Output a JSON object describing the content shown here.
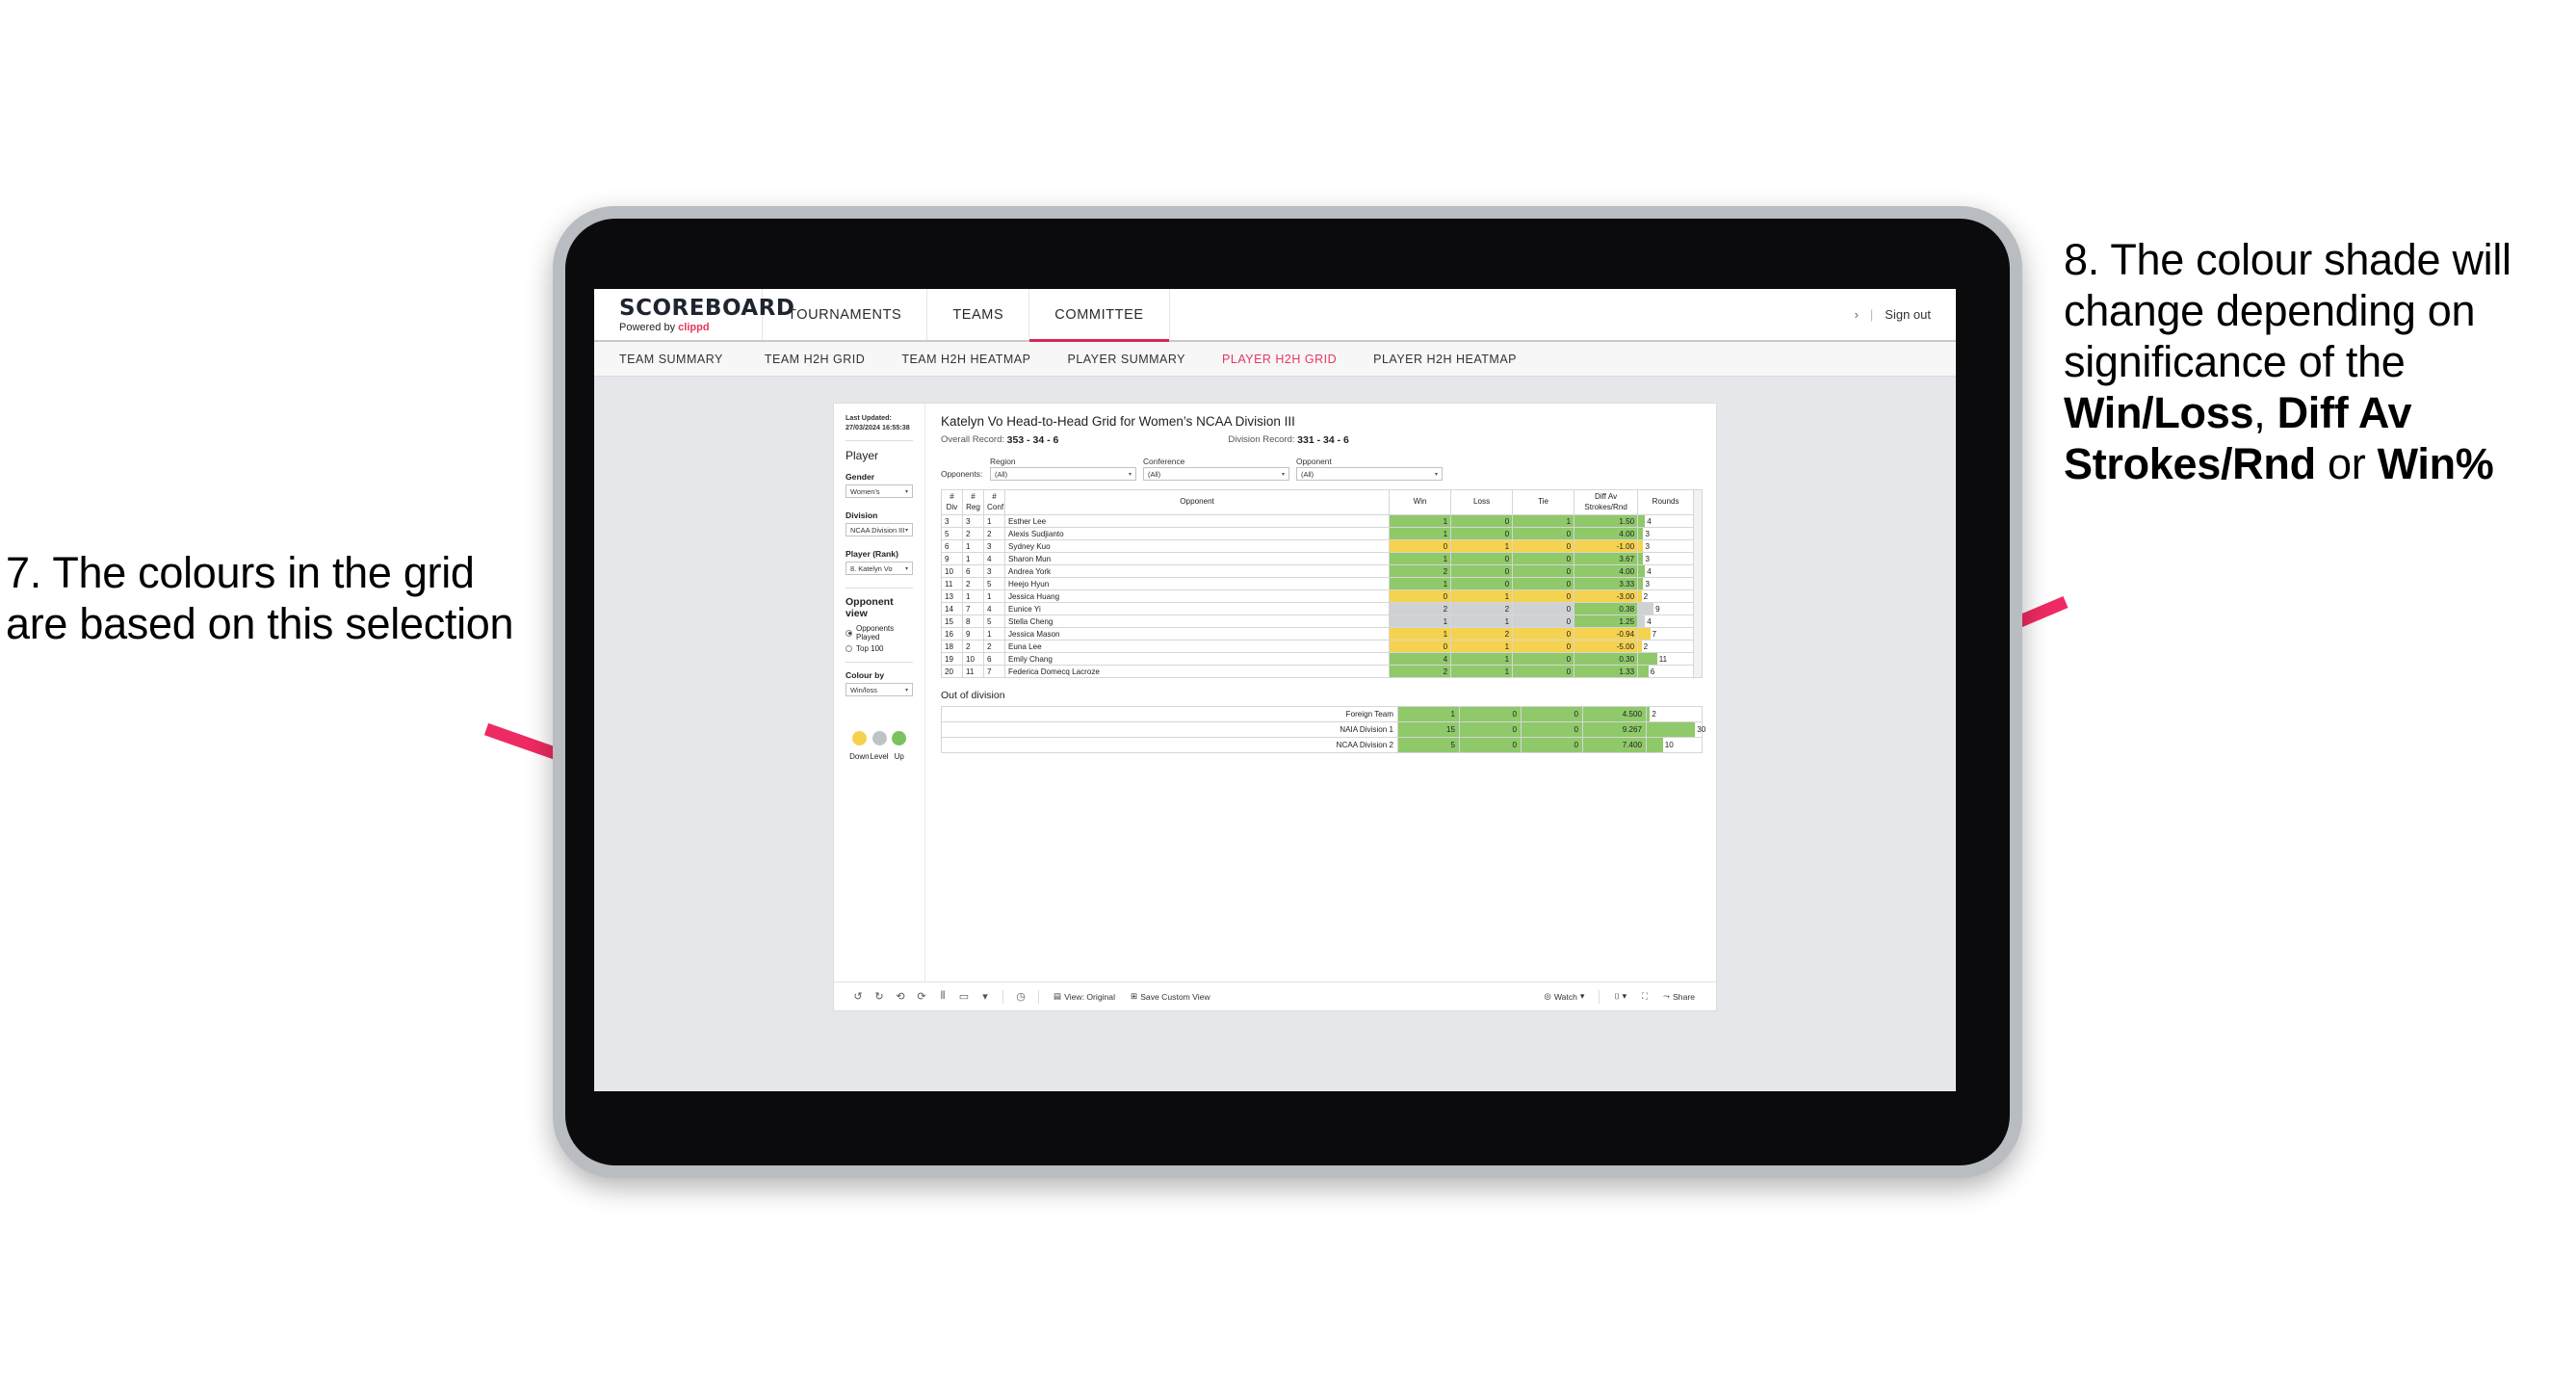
{
  "annotations": {
    "left": {
      "parts": [
        {
          "t": "7. The colours in the grid are based on this selection",
          "b": false
        }
      ]
    },
    "right": {
      "parts": [
        {
          "t": "8. The colour shade will change depending on significance of the ",
          "b": false
        },
        {
          "t": "Win/Loss",
          "b": true
        },
        {
          "t": ", ",
          "b": false
        },
        {
          "t": "Diff Av Strokes/Rnd",
          "b": true
        },
        {
          "t": " or ",
          "b": false
        },
        {
          "t": "Win%",
          "b": true
        }
      ]
    },
    "arrow_color": "#ee2a62"
  },
  "app": {
    "brand": {
      "title": "SCOREBOARD",
      "powered_prefix": "Powered by ",
      "powered_brand": "clippd"
    },
    "top_nav": [
      {
        "label": "TOURNAMENTS",
        "active": false
      },
      {
        "label": "TEAMS",
        "active": false
      },
      {
        "label": "COMMITTEE",
        "active": true
      }
    ],
    "top_right": {
      "chevron": "›",
      "separator": "|",
      "sign_out": "Sign out"
    },
    "sub_nav": [
      {
        "label": "TEAM SUMMARY",
        "active": false
      },
      {
        "label": "TEAM H2H GRID",
        "active": false
      },
      {
        "label": "TEAM H2H HEATMAP",
        "active": false
      },
      {
        "label": "PLAYER SUMMARY",
        "active": false
      },
      {
        "label": "PLAYER H2H GRID",
        "active": true
      },
      {
        "label": "PLAYER H2H HEATMAP",
        "active": false
      }
    ],
    "accent_color": "#e8365d"
  },
  "panel": {
    "last_updated": "Last Updated: 27/03/2024 16:55:38",
    "heading": "Player",
    "fields": [
      {
        "label": "Gender",
        "value": "Women’s"
      },
      {
        "label": "Division",
        "value": "NCAA Division III"
      },
      {
        "label": "Player (Rank)",
        "value": "8. Katelyn Vo"
      }
    ],
    "opponent_view": {
      "heading": "Opponent view",
      "options": [
        {
          "label": "Opponents Played",
          "selected": true
        },
        {
          "label": "Top 100",
          "selected": false
        }
      ]
    },
    "colour_by": {
      "label": "Colour by",
      "value": "Win/loss"
    },
    "legend": [
      {
        "label": "Down",
        "color": "#f4d14e"
      },
      {
        "label": "Level",
        "color": "#bfc3c7"
      },
      {
        "label": "Up",
        "color": "#7ac35c"
      }
    ]
  },
  "main": {
    "title": "Katelyn Vo Head-to-Head Grid for Women’s NCAA Division III",
    "overall_record_label": "Overall Record:",
    "overall_record_value": "353 -  34 - 6",
    "division_record_label": "Division Record:",
    "division_record_value": "331 -  34 - 6",
    "opponents_label": "Opponents:",
    "opponent_filters": [
      {
        "label": "Region",
        "value": "(All)"
      },
      {
        "label": "Conference",
        "value": "(All)"
      },
      {
        "label": "Opponent",
        "value": "(All)"
      }
    ],
    "out_of_division_heading": "Out of division"
  },
  "chart_data": {
    "type": "table",
    "title": "Katelyn Vo Head-to-Head Grid for Women’s NCAA Division III",
    "columns": [
      "# Div",
      "# Reg",
      "# Conf",
      "Opponent",
      "Win",
      "Loss",
      "Tie",
      "Diff Av Strokes/Rnd",
      "Rounds"
    ],
    "column_header_lines": [
      [
        "#",
        "Div"
      ],
      [
        "#",
        "Reg"
      ],
      [
        "#",
        "Conf"
      ],
      [
        "Opponent",
        ""
      ],
      [
        "Win",
        ""
      ],
      [
        "Loss",
        ""
      ],
      [
        "Tie",
        ""
      ],
      [
        "Diff Av",
        "Strokes/Rnd"
      ],
      [
        "Rounds",
        ""
      ]
    ],
    "colors": {
      "up": "#8fc96a",
      "down": "#f5d24f",
      "level": "#cfd2d4",
      "white": "#ffffff"
    },
    "rounds_max": 32,
    "rows": [
      {
        "div": "3",
        "reg": "3",
        "conf": "1",
        "opponent": "Esther Lee",
        "win": "1",
        "loss": "0",
        "tie": "1",
        "diff": "1.50",
        "rounds": "4",
        "state": "up"
      },
      {
        "div": "5",
        "reg": "2",
        "conf": "2",
        "opponent": "Alexis Sudjianto",
        "win": "1",
        "loss": "0",
        "tie": "0",
        "diff": "4.00",
        "rounds": "3",
        "state": "up"
      },
      {
        "div": "6",
        "reg": "1",
        "conf": "3",
        "opponent": "Sydney Kuo",
        "win": "0",
        "loss": "1",
        "tie": "0",
        "diff": "-1.00",
        "rounds": "3",
        "state": "down"
      },
      {
        "div": "9",
        "reg": "1",
        "conf": "4",
        "opponent": "Sharon Mun",
        "win": "1",
        "loss": "0",
        "tie": "0",
        "diff": "3.67",
        "rounds": "3",
        "state": "up"
      },
      {
        "div": "10",
        "reg": "6",
        "conf": "3",
        "opponent": "Andrea York",
        "win": "2",
        "loss": "0",
        "tie": "0",
        "diff": "4.00",
        "rounds": "4",
        "state": "up"
      },
      {
        "div": "11",
        "reg": "2",
        "conf": "5",
        "opponent": "Heejo Hyun",
        "win": "1",
        "loss": "0",
        "tie": "0",
        "diff": "3.33",
        "rounds": "3",
        "state": "up"
      },
      {
        "div": "13",
        "reg": "1",
        "conf": "1",
        "opponent": "Jessica Huang",
        "win": "0",
        "loss": "1",
        "tie": "0",
        "diff": "-3.00",
        "rounds": "2",
        "state": "down"
      },
      {
        "div": "14",
        "reg": "7",
        "conf": "4",
        "opponent": "Eunice Yi",
        "win": "2",
        "loss": "2",
        "tie": "0",
        "diff": "0.38",
        "rounds": "9",
        "state": "level",
        "diff_state": "up"
      },
      {
        "div": "15",
        "reg": "8",
        "conf": "5",
        "opponent": "Stella Cheng",
        "win": "1",
        "loss": "1",
        "tie": "0",
        "diff": "1.25",
        "rounds": "4",
        "state": "level",
        "diff_state": "up"
      },
      {
        "div": "16",
        "reg": "9",
        "conf": "1",
        "opponent": "Jessica Mason",
        "win": "1",
        "loss": "2",
        "tie": "0",
        "diff": "-0.94",
        "rounds": "7",
        "state": "down"
      },
      {
        "div": "18",
        "reg": "2",
        "conf": "2",
        "opponent": "Euna Lee",
        "win": "0",
        "loss": "1",
        "tie": "0",
        "diff": "-5.00",
        "rounds": "2",
        "state": "down"
      },
      {
        "div": "19",
        "reg": "10",
        "conf": "6",
        "opponent": "Emily Chang",
        "win": "4",
        "loss": "1",
        "tie": "0",
        "diff": "0.30",
        "rounds": "11",
        "state": "up"
      },
      {
        "div": "20",
        "reg": "11",
        "conf": "7",
        "opponent": "Federica Domecq Lacroze",
        "win": "2",
        "loss": "1",
        "tie": "0",
        "diff": "1.33",
        "rounds": "6",
        "state": "up"
      }
    ],
    "out_of_division": {
      "heading": "Out of division",
      "rounds_max": 34,
      "rows": [
        {
          "label": "Foreign Team",
          "win": "1",
          "loss": "0",
          "tie": "0",
          "diff": "4.500",
          "rounds": "2",
          "state": "up"
        },
        {
          "label": "NAIA Division 1",
          "win": "15",
          "loss": "0",
          "tie": "0",
          "diff": "9.267",
          "rounds": "30",
          "state": "up"
        },
        {
          "label": "NCAA Division 2",
          "win": "5",
          "loss": "0",
          "tie": "0",
          "diff": "7.400",
          "rounds": "10",
          "state": "up"
        }
      ]
    }
  },
  "toolbar": {
    "icons": [
      "undo-icon",
      "redo-icon",
      "revert-icon",
      "refresh-icon",
      "pause-icon",
      "shape-icon",
      "dropdown-caret-icon"
    ],
    "history_icon": "history-icon",
    "view_label": "View: Original",
    "save_label": "Save Custom View",
    "watch_label": "Watch",
    "share_label": "Share",
    "device_icon": "device-icon",
    "fullscreen_icon": "fullscreen-icon",
    "share_icon": "share-icon"
  }
}
